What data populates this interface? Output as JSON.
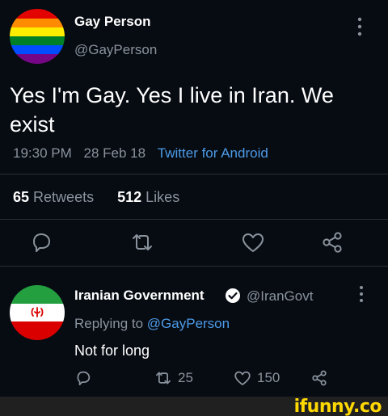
{
  "tweet": {
    "display_name": "Gay Person",
    "handle": "@GayPerson",
    "text": "Yes I'm Gay. Yes I live in Iran. We exist",
    "time": "19:30 PM",
    "date": "28 Feb 18",
    "source": "Twitter for Android",
    "retweet_count": "65",
    "retweet_label": "Retweets",
    "like_count": "512",
    "like_label": "Likes"
  },
  "reply": {
    "display_name": "Iranian Government",
    "handle": "@IranGovt",
    "replying_prefix": "Replying to",
    "replying_to": "@GayPerson",
    "text": "Not for long",
    "retweet_count": "25",
    "like_count": "150"
  },
  "icons": [
    "rainbow-avatar-icon",
    "more-icon",
    "reply-icon",
    "retweet-icon",
    "like-icon",
    "share-icon",
    "iran-flag-avatar-icon",
    "verified-icon"
  ],
  "colors": {
    "background": "#070b12",
    "muted_text": "#8a939d",
    "link": "#4d9be8",
    "divider": "#2a3038",
    "watermark": "#ffd800"
  },
  "watermark": "ifunny.co"
}
